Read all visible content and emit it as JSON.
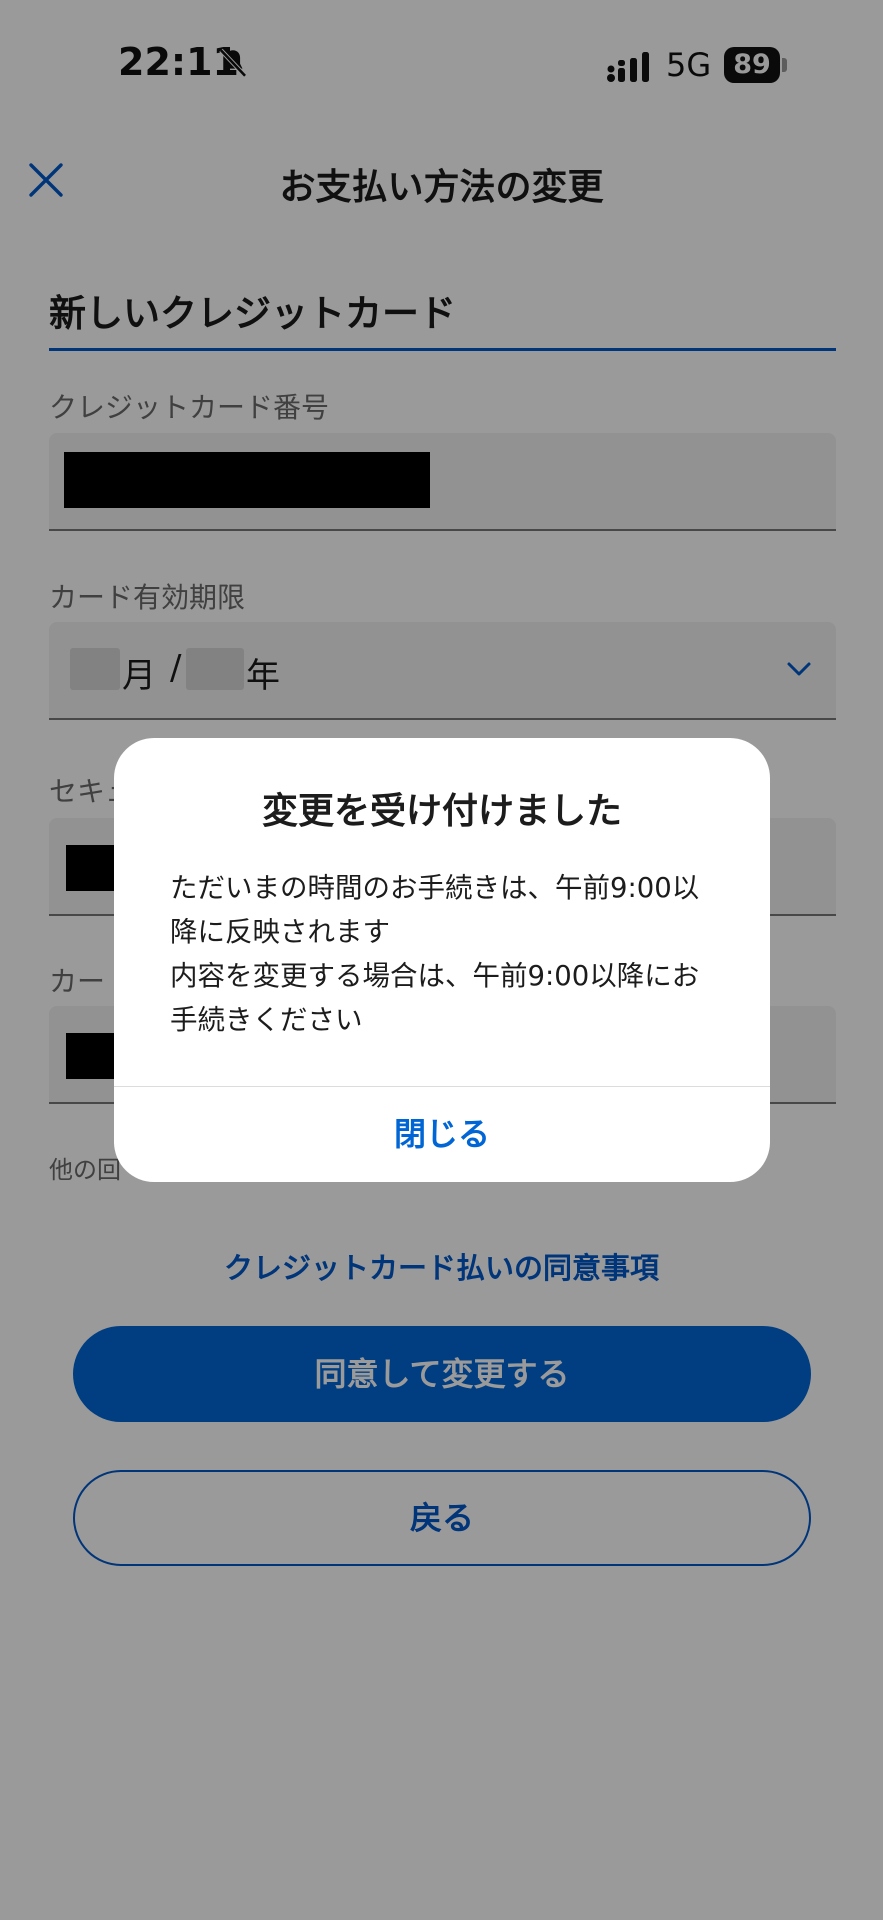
{
  "status_bar": {
    "time": "22:11",
    "network": "5G",
    "battery": "89"
  },
  "header": {
    "title": "お支払い方法の変更",
    "close_icon": "close-icon"
  },
  "form": {
    "section_title": "新しいクレジットカード",
    "card_number": {
      "label": "クレジットカード番号"
    },
    "expiry": {
      "label": "カード有効期限",
      "month_unit": "月",
      "separator": "/",
      "year_unit": "年"
    },
    "security_code": {
      "label": "セキュ"
    },
    "card_holder": {
      "label": "カー"
    },
    "other_note": "他の回"
  },
  "agreement_link": "クレジットカード払いの同意事項",
  "buttons": {
    "agree": "同意して変更する",
    "back": "戻る"
  },
  "dialog": {
    "title": "変更を受け付けました",
    "body_lines": [
      "ただいまの時間のお手続きは、午前9:00以",
      "降に反映されます",
      "内容を変更する場合は、午前9:00以降にお",
      "手続きください"
    ],
    "close_label": "閉じる"
  },
  "colors": {
    "accent": "#0066d6",
    "overlay": "rgba(0,0,0,0.4)"
  }
}
